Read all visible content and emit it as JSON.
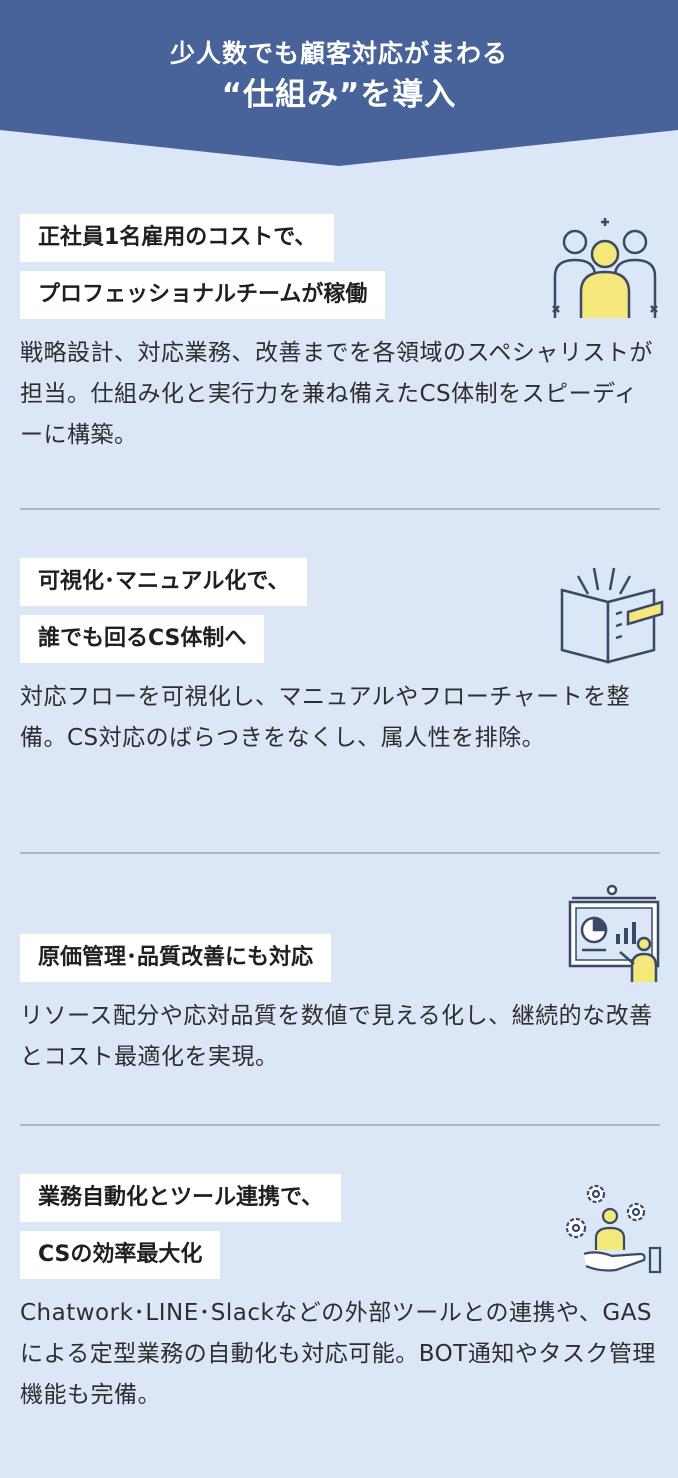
{
  "header": {
    "line1": "少人数でも顧客対応がまわる",
    "line2": "“仕組み”を導入"
  },
  "sections": [
    {
      "title_lines": [
        "正社員1名雇用のコストで、",
        "プロフェッショナルチームが稼働"
      ],
      "body": "戦略設計、対応業務、改善までを各領域のスペシャリストが担当。仕組み化と実行力を兼ね備えたCS体制をスピーディーに構築。",
      "icon": "team-icon"
    },
    {
      "title_lines": [
        "可視化･マニュアル化で、",
        "誰でも回るCS体制へ"
      ],
      "body": "対応フローを可視化し、マニュアルやフローチャートを整備。CS対応のばらつきをなくし、属人性を排除。",
      "icon": "manual-book-icon"
    },
    {
      "title_lines": [
        "原価管理･品質改善にも対応"
      ],
      "body": "リソース配分や応対品質を数値で見える化し、継続的な改善とコスト最適化を実現。",
      "icon": "presentation-chart-icon"
    },
    {
      "title_lines": [
        "業務自動化とツール連携で、",
        "CSの効率最大化"
      ],
      "body": "Chatwork･LINE･Slackなどの外部ツールとの連携や、GASによる定型業務の自動化も対応可能。BOT通知やタスク管理機能も完備。",
      "icon": "automation-gears-icon"
    }
  ],
  "colors": {
    "banner": "#48639a",
    "background": "#dbe6f6",
    "divider": "#a9b7cc",
    "accent_yellow": "#f5e87a",
    "icon_stroke": "#3a4a66"
  }
}
